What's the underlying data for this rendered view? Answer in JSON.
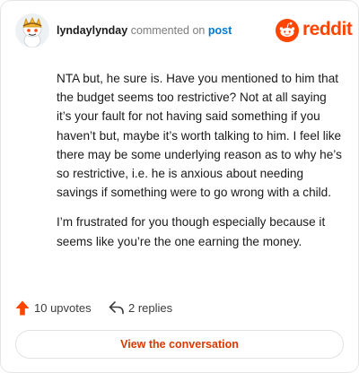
{
  "header": {
    "username": "lyndaylynday",
    "action_text": "commented on",
    "target_link": "post",
    "brand": "reddit",
    "avatar_icon": "snoo-avatar-icon",
    "logo_icon": "reddit-logo-icon"
  },
  "comment": {
    "paragraphs": [
      "NTA but, he sure is. Have you mentioned to him that the budget seems too restrictive? Not at all saying it’s your fault for not having said something if you haven’t but, maybe it’s worth talking to him. I feel like there may be some underlying reason as to why he’s so restrictive, i.e. he is anxious about needing savings if something were to go wrong with a child.",
      "I’m frustrated for you though especially because it seems like you’re the one earning the money."
    ]
  },
  "actions": {
    "upvotes": "10 upvotes",
    "replies": "2 replies",
    "upvote_icon": "upvote-arrow-icon",
    "reply_icon": "reply-arrow-icon"
  },
  "cta": {
    "label": "View the conversation"
  },
  "colors": {
    "brand": "#ff4500",
    "link": "#0079d3",
    "cta_text": "#d93900"
  }
}
